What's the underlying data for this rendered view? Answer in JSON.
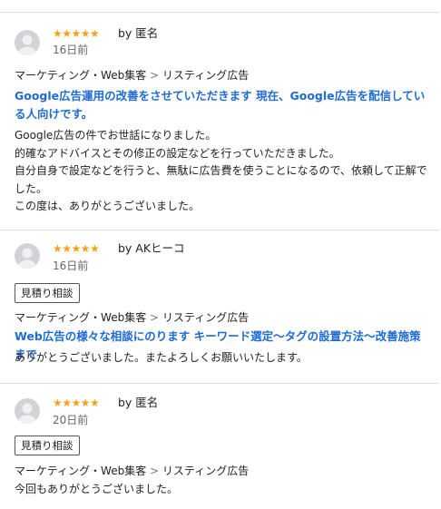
{
  "reviews": [
    {
      "rating_stars": "★★★★★",
      "rating": 5,
      "reviewer": "by 匿名",
      "date": "16日前",
      "category": "マーケティング・Web集客",
      "separator": ">",
      "subcategory": "リスティング広告",
      "service_title": "Google広告運用の改善をさせていただきます 現在、Google広告を配信している人向けです。",
      "body": [
        "Google広告の件でお世話になりました。",
        "的確なアドバイスとその修正の設定などを行っていただきました。",
        "自分自身で設定などを行うと、無駄に広告費を使うことになるので、依頼して正解でした。",
        "この度は、ありがとうございました。"
      ]
    },
    {
      "rating_stars": "★★★★★",
      "rating": 5,
      "reviewer": "by AKヒーコ",
      "date": "16日前",
      "badge": "見積り相談",
      "category": "マーケティング・Web集客",
      "separator": ">",
      "subcategory": "リスティング広告",
      "service_title": "Web広告の様々な相談にのります キーワード選定〜タグの設置方法〜改善施策まで",
      "body": [
        "ありがとうございました。またよろしくお願いいたします。"
      ]
    },
    {
      "rating_stars": "★★★★★",
      "rating": 5,
      "reviewer": "by 匿名",
      "date": "20日前",
      "badge": "見積り相談",
      "category": "マーケティング・Web集客",
      "separator": ">",
      "subcategory": "リスティング広告",
      "body": [
        "今回もありがとうございました。"
      ]
    }
  ],
  "colors": {
    "star": "#f5a21b",
    "link": "#1f6bd6",
    "divider": "#dcdcdc"
  }
}
